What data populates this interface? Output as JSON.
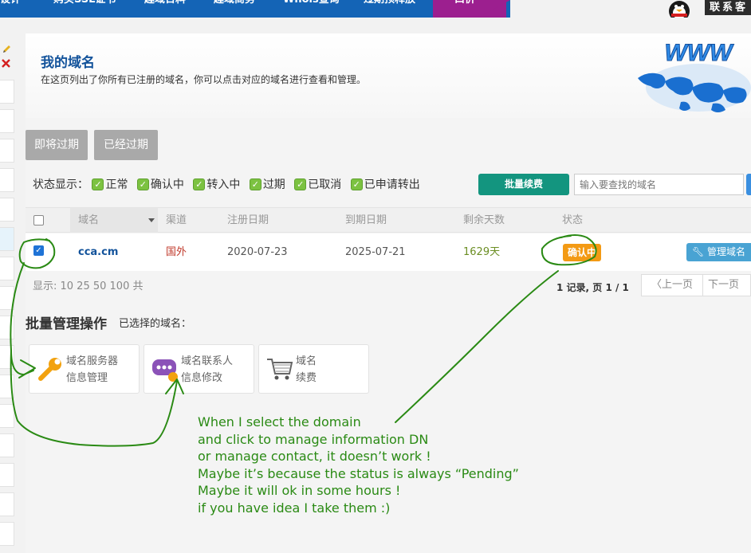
{
  "nav": {
    "items": [
      "设计",
      "购买SSL证书",
      "趣域日料",
      "趣域商务",
      "Whois查询",
      "过期预释放"
    ],
    "active": "一口价",
    "contact": "联系客"
  },
  "header": {
    "title": "我的域名",
    "description": "在这页列出了你所有已注册的域名，你可以点击对应的域名进行查看和管理。"
  },
  "tabs": [
    "即将过期",
    "已经过期"
  ],
  "status_filter": {
    "label": "状态显示：",
    "options": [
      "正常",
      "确认中",
      "转入中",
      "过期",
      "已取消",
      "已申请转出"
    ]
  },
  "toolbar": {
    "renew_label": "批量续费",
    "search_placeholder": "输入要查找的域名"
  },
  "table": {
    "columns": [
      "域名",
      "渠道",
      "注册日期",
      "到期日期",
      "剩余天数",
      "状态"
    ],
    "rows": [
      {
        "domain": "cca.cm",
        "channel": "国外",
        "registered": "2020-07-23",
        "expires": "2025-07-21",
        "days_left": "1629天",
        "status": "确认中",
        "action": "管理域名"
      }
    ]
  },
  "pagination": {
    "show": "显示: 10 25 50 100 共",
    "records": "1 记录, 页 1 / 1",
    "prev": "上一页",
    "next": "下一页"
  },
  "batch": {
    "title": "批量管理操作",
    "selected": "已选择的域名：",
    "cards": [
      {
        "line1": "域名服务器",
        "line2": "信息管理",
        "icon": "wrench-icon"
      },
      {
        "line1": "域名联系人",
        "line2": "信息修改",
        "icon": "chat-icon"
      },
      {
        "line1": "域名",
        "line2": "续费",
        "icon": "cart-icon"
      }
    ]
  },
  "annotation": {
    "lines": [
      "When I select the domain",
      "and click to manage information DN",
      "or manage contact, it doesn’t work !",
      "Maybe it’s because the status is always “Pending”",
      "Maybe it will ok in some hours !",
      "if you have idea I take them :)"
    ],
    "color": "#2a8a14"
  },
  "colors": {
    "nav_bg": "#1464b6",
    "nav_active": "#9c1f8f",
    "title": "#13539b",
    "renew": "#13957f",
    "status_badge": "#f39a14",
    "manage_btn": "#49a3d3",
    "check": "#7cc241"
  }
}
